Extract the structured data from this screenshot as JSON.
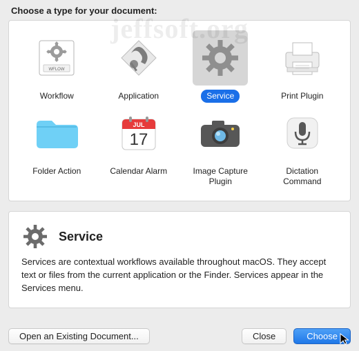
{
  "watermark": "jeffsoft.org",
  "heading": "Choose a type for your document:",
  "types": [
    {
      "id": "workflow",
      "label": "Workflow",
      "selected": false
    },
    {
      "id": "application",
      "label": "Application",
      "selected": false
    },
    {
      "id": "service",
      "label": "Service",
      "selected": true
    },
    {
      "id": "print-plugin",
      "label": "Print Plugin",
      "selected": false
    },
    {
      "id": "folder-action",
      "label": "Folder Action",
      "selected": false
    },
    {
      "id": "calendar-alarm",
      "label": "Calendar Alarm",
      "selected": false
    },
    {
      "id": "image-capture",
      "label": "Image Capture\nPlugin",
      "selected": false
    },
    {
      "id": "dictation",
      "label": "Dictation\nCommand",
      "selected": false
    }
  ],
  "detail": {
    "title": "Service",
    "description": "Services are contextual workflows available throughout macOS. They accept text or files from the current application or the Finder. Services appear in the Services menu."
  },
  "buttons": {
    "open_existing": "Open an Existing Document...",
    "close": "Close",
    "choose": "Choose"
  },
  "calendar_icon": {
    "month": "JUL",
    "day": "17"
  }
}
